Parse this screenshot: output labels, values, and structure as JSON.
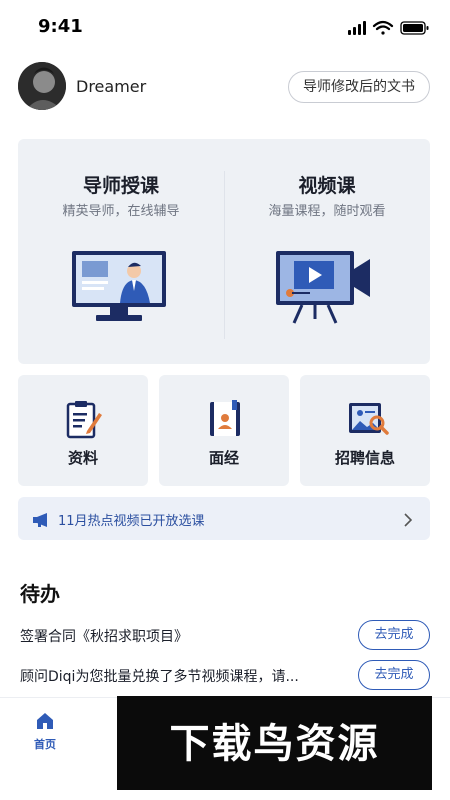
{
  "status_bar": {
    "time": "9:41"
  },
  "profile": {
    "username": "Dreamer",
    "doc_button": "导师修改后的文书"
  },
  "courses": [
    {
      "title": "导师授课",
      "subtitle": "精英导师，在线辅导"
    },
    {
      "title": "视频课",
      "subtitle": "海量课程，随时观看"
    }
  ],
  "quick_links": [
    {
      "label": "资料",
      "icon": "clipboard-pen-icon"
    },
    {
      "label": "面经",
      "icon": "interview-book-icon"
    },
    {
      "label": "招聘信息",
      "icon": "job-search-icon"
    }
  ],
  "notice": {
    "text": "11月热点视频已开放选课",
    "icon": "megaphone-icon"
  },
  "todo": {
    "heading": "待办",
    "items": [
      {
        "text": "签署合同《秋招求职项目》",
        "action": "去完成"
      },
      {
        "text": "顾问Diqi为您批量兑换了多节视频课程，请...",
        "action": "去完成"
      }
    ]
  },
  "bottom_nav": {
    "home_label": "首页"
  },
  "watermark": {
    "text": "下载鸟资源"
  },
  "colors": {
    "accent": "#2f5bb7",
    "navy": "#1c2c63",
    "card_bg": "#eef1f5"
  }
}
